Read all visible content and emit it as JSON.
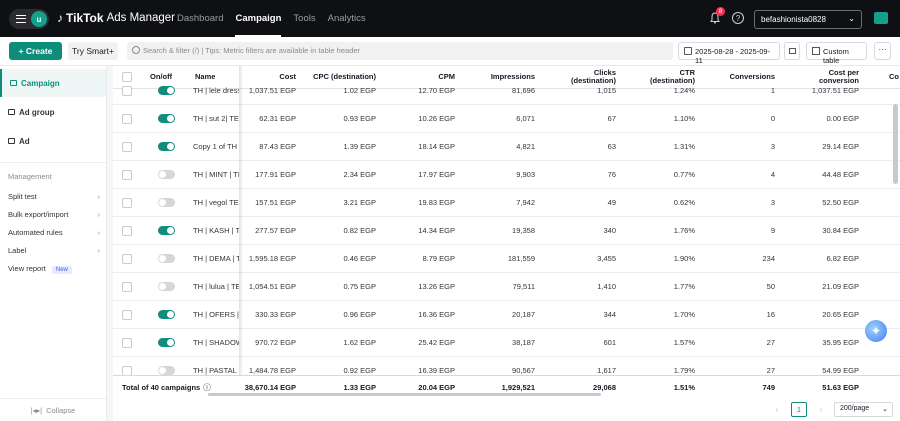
{
  "topbar": {
    "avatar_letter": "u",
    "brand": "TikTok",
    "brand_sub": "Ads Manager",
    "nav": [
      "Dashboard",
      "Campaign",
      "Tools",
      "Analytics"
    ],
    "active_nav": "Campaign",
    "notification_count": "8",
    "account_name": "befashionista0828"
  },
  "toolbar": {
    "create_label": "Create",
    "smart_label": "Try Smart+",
    "search_placeholder": "Search & filter (/) | Tips: Metric filters are available in table header",
    "date_range": "2025-08-28 - 2025-09-11",
    "custom_table_label": "Custom table",
    "more_label": "···"
  },
  "sidebar": {
    "levels": [
      "Campaign",
      "Ad group",
      "Ad"
    ],
    "management_title": "Management",
    "links": [
      {
        "label": "Split test",
        "arrow": "›"
      },
      {
        "label": "Bulk export/import",
        "arrow": "›"
      },
      {
        "label": "Automated rules",
        "arrow": "›"
      },
      {
        "label": "Label",
        "arrow": "›"
      },
      {
        "label": "View report",
        "badge": "New"
      }
    ],
    "collapse_label": "Collapse"
  },
  "table": {
    "headers": {
      "onoff": "On/off",
      "name": "Name",
      "cost": "Cost",
      "cpc": "CPC (destination)",
      "cpm": "CPM",
      "impressions": "Impressions",
      "clicks": "Clicks (destination)",
      "ctr": "CTR (destination)",
      "conversions": "Conversions",
      "cpconv": "Cost per conversion",
      "extra": "Co"
    },
    "rows": [
      {
        "on": true,
        "name": "TH | lele dress",
        "cost": "1,037.51 EGP",
        "cpc": "1.02 EGP",
        "cpm": "12.70 EGP",
        "impressions": "81,696",
        "clicks": "1,015",
        "ctr": "1.24%",
        "conversions": "1",
        "cpconv": "1,037.51 EGP"
      },
      {
        "on": true,
        "name": "TH | sut 2| TE",
        "cost": "62.31 EGP",
        "cpc": "0.93 EGP",
        "cpm": "10.26 EGP",
        "impressions": "6,071",
        "clicks": "67",
        "ctr": "1.10%",
        "conversions": "0",
        "cpconv": "0.00 EGP"
      },
      {
        "on": true,
        "name": "Copy 1 of TH",
        "cost": "87.43 EGP",
        "cpc": "1.39 EGP",
        "cpm": "18.14 EGP",
        "impressions": "4,821",
        "clicks": "63",
        "ctr": "1.31%",
        "conversions": "3",
        "cpconv": "29.14 EGP"
      },
      {
        "on": false,
        "name": "TH | MINT | TE",
        "cost": "177.91 EGP",
        "cpc": "2.34 EGP",
        "cpm": "17.97 EGP",
        "impressions": "9,903",
        "clicks": "76",
        "ctr": "0.77%",
        "conversions": "4",
        "cpconv": "44.48 EGP"
      },
      {
        "on": false,
        "name": "TH | vegol TES",
        "cost": "157.51 EGP",
        "cpc": "3.21 EGP",
        "cpm": "19.83 EGP",
        "impressions": "7,942",
        "clicks": "49",
        "ctr": "0.62%",
        "conversions": "3",
        "cpconv": "52.50 EGP"
      },
      {
        "on": true,
        "name": "TH | KASH | T",
        "cost": "277.57 EGP",
        "cpc": "0.82 EGP",
        "cpm": "14.34 EGP",
        "impressions": "19,358",
        "clicks": "340",
        "ctr": "1.76%",
        "conversions": "9",
        "cpconv": "30.84 EGP"
      },
      {
        "on": false,
        "name": "TH | DEMA | T",
        "cost": "1,595.18 EGP",
        "cpc": "0.46 EGP",
        "cpm": "8.79 EGP",
        "impressions": "181,559",
        "clicks": "3,455",
        "ctr": "1.90%",
        "conversions": "234",
        "cpconv": "6.82 EGP"
      },
      {
        "on": false,
        "name": "TH | lulua | TE",
        "cost": "1,054.51 EGP",
        "cpc": "0.75 EGP",
        "cpm": "13.26 EGP",
        "impressions": "79,511",
        "clicks": "1,410",
        "ctr": "1.77%",
        "conversions": "50",
        "cpconv": "21.09 EGP"
      },
      {
        "on": true,
        "name": "TH | OFERS | T",
        "cost": "330.33 EGP",
        "cpc": "0.96 EGP",
        "cpm": "16.36 EGP",
        "impressions": "20,187",
        "clicks": "344",
        "ctr": "1.70%",
        "conversions": "16",
        "cpconv": "20.65 EGP"
      },
      {
        "on": true,
        "name": "TH | SHADOW",
        "cost": "970.72 EGP",
        "cpc": "1.62 EGP",
        "cpm": "25.42 EGP",
        "impressions": "38,187",
        "clicks": "601",
        "ctr": "1.57%",
        "conversions": "27",
        "cpconv": "35.95 EGP"
      },
      {
        "on": false,
        "name": "TH | PASTAL |",
        "cost": "1,484.78 EGP",
        "cpc": "0.92 EGP",
        "cpm": "16.39 EGP",
        "impressions": "90,567",
        "clicks": "1,617",
        "ctr": "1.79%",
        "conversions": "27",
        "cpconv": "54.99 EGP"
      }
    ],
    "total": {
      "label": "Total of 40 campaigns",
      "cost": "38,670.14 EGP",
      "cpc": "1.33 EGP",
      "cpm": "20.04 EGP",
      "impressions": "1,929,521",
      "clicks": "29,068",
      "ctr": "1.51%",
      "conversions": "749",
      "cpconv": "51.63 EGP"
    }
  },
  "pagination": {
    "prev": "‹",
    "page": "1",
    "next": "›",
    "per_page": "200/page"
  }
}
